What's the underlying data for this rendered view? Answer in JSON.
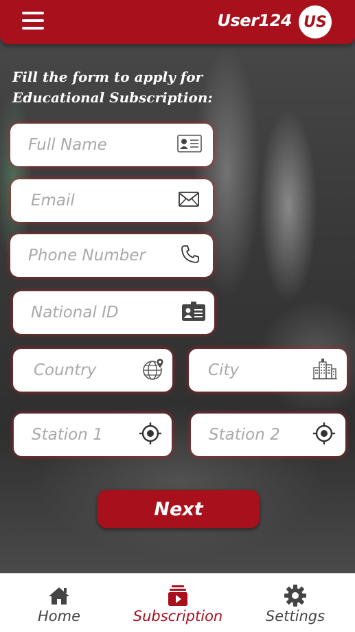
{
  "header": {
    "username": "User124",
    "avatar_initials": "US"
  },
  "form": {
    "title_line1": "Fill the form to apply for",
    "title_line2": "Educational Subscription:",
    "fields": {
      "full_name": "Full Name",
      "email": "Email",
      "phone": "Phone Number",
      "national_id": "National ID",
      "country": "Country",
      "city": "City",
      "station1": "Station 1",
      "station2": "Station 2"
    },
    "next_label": "Next"
  },
  "nav": {
    "home": "Home",
    "subscription": "Subscription",
    "settings": "Settings",
    "active": "subscription"
  },
  "colors": {
    "brand": "#a8101b",
    "placeholder": "#a9a9a9"
  }
}
